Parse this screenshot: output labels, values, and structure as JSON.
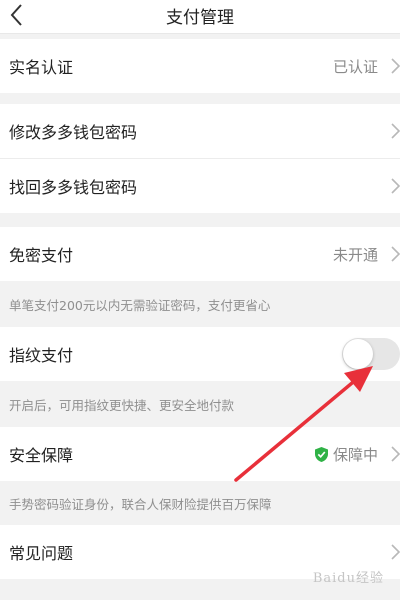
{
  "header": {
    "title": "支付管理",
    "back_icon": "chevron-left-icon"
  },
  "sections": {
    "real_name": {
      "label": "实名认证",
      "value": "已认证"
    },
    "change_password": {
      "label": "修改多多钱包密码"
    },
    "recover_password": {
      "label": "找回多多钱包密码"
    },
    "password_free": {
      "label": "免密支付",
      "value": "未开通",
      "note": "单笔支付200元以内无需验证密码，支付更省心"
    },
    "fingerprint": {
      "label": "指纹支付",
      "enabled": false,
      "note": "开启后，可用指纹更快捷、更安全地付款"
    },
    "security": {
      "label": "安全保障",
      "value": "保障中",
      "icon": "shield-check-icon",
      "icon_color": "#2fb246",
      "note": "手势密码验证身份，联合人保财险提供百万保障"
    },
    "faq": {
      "label": "常见问题"
    }
  },
  "annotation": {
    "arrow_color": "#e8303a"
  },
  "watermark": "Baidu经验"
}
